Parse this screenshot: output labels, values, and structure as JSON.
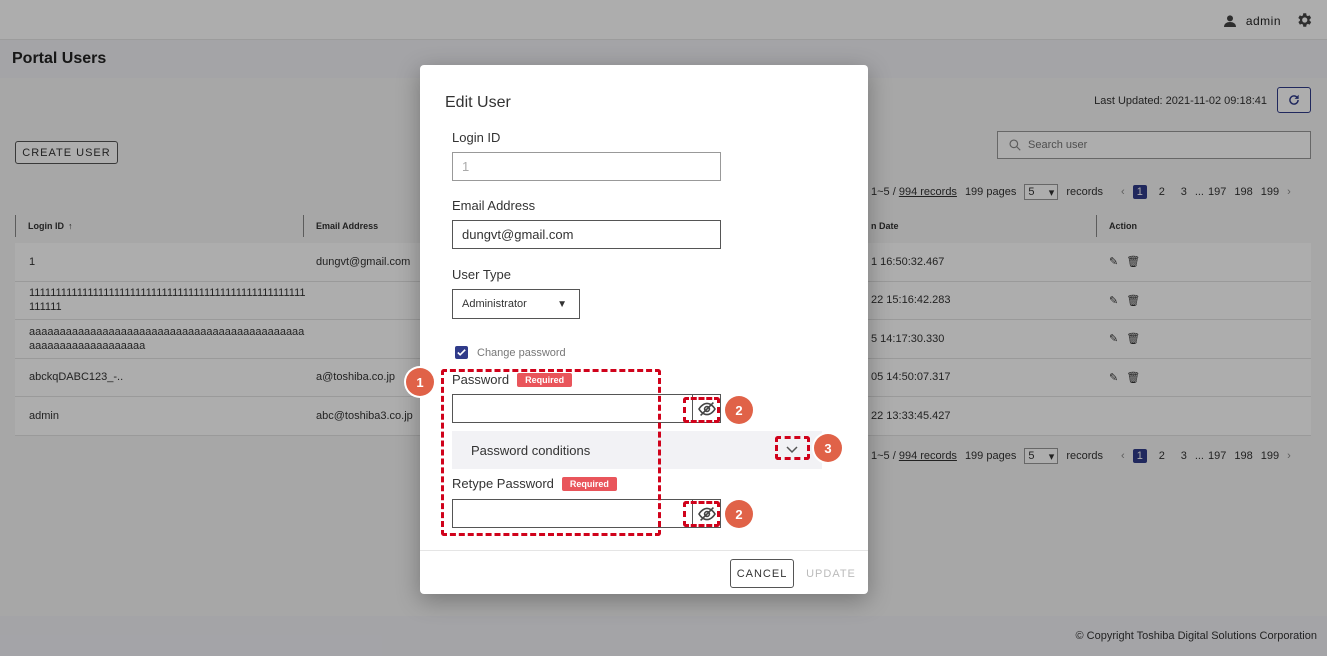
{
  "topbar": {
    "username": "admin"
  },
  "page": {
    "title": "Portal Users",
    "last_updated": "Last Updated: 2021-11-02 09:18:41",
    "create_label": "CREATE USER",
    "search_placeholder": "Search user"
  },
  "pager": {
    "range": "1~5 /",
    "records_link": "994 records",
    "pages_text": "199 pages",
    "page_size": "5",
    "records_word": "records",
    "pages": [
      "1",
      "2",
      "3",
      "...",
      "197",
      "198",
      "199"
    ]
  },
  "table": {
    "headers": [
      "Login ID",
      "Email Address",
      "n Date",
      "Action"
    ],
    "rows": [
      {
        "login": "1",
        "email": "dungvt@gmail.com",
        "date": "1 16:50:32.467"
      },
      {
        "login": "1111111111111111111111111111111111111111111111111111111111",
        "email": "",
        "date": "22 15:16:42.283"
      },
      {
        "login": "aaaaaaaaaaaaaaaaaaaaaaaaaaaaaaaaaaaaaaaaaaaaaaaaaaaaaaaaaaaaaaaa",
        "email": "",
        "date": "5 14:17:30.330"
      },
      {
        "login": "abckqDABC123_-..",
        "email": "a@toshiba.co.jp",
        "date": "05 14:50:07.317"
      },
      {
        "login": "admin",
        "email": "abc@toshiba3.co.jp",
        "date": "22 13:33:45.427"
      }
    ]
  },
  "dialog": {
    "title": "Edit User",
    "login_label": "Login ID",
    "login_value": "1",
    "email_label": "Email Address",
    "email_value": "dungvt@gmail.com",
    "usertype_label": "User Type",
    "usertype_value": "Administrator",
    "change_password_label": "Change password",
    "password_label": "Password",
    "required_label": "Required",
    "conditions_label": "Password conditions",
    "retype_label": "Retype Password",
    "cancel_label": "CANCEL",
    "update_label": "UPDATE"
  },
  "annotations": {
    "b1": "1",
    "b2": "2",
    "b3": "3"
  },
  "footer": {
    "copyright": "© Copyright Toshiba Digital Solutions Corporation"
  },
  "colors": {
    "primary": "#303b8a",
    "required": "#e9555b",
    "annotation": "#d0021b",
    "badge": "#e06248"
  }
}
